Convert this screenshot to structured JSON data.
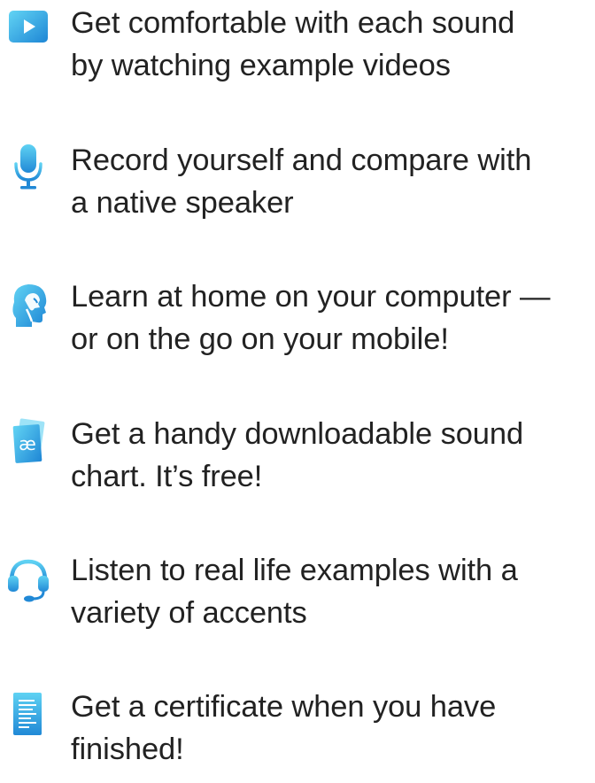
{
  "colors": {
    "accent_light": "#5dcff2",
    "accent_dark": "#1e88d6",
    "text": "#222222",
    "background": "#ffffff"
  },
  "features": [
    {
      "icon": "play-video-icon",
      "text": "Get comfortable with each sound\nby watching example videos"
    },
    {
      "icon": "microphone-icon",
      "text": "Record yourself and compare with\na native speaker"
    },
    {
      "icon": "head-profile-icon",
      "text": "Learn at home on your computer —\nor on the go on your mobile!"
    },
    {
      "icon": "sound-chart-cards-icon",
      "icon_text": "æ",
      "text": "Get a handy downloadable sound\nchart. It’s free!"
    },
    {
      "icon": "headset-icon",
      "text": "Listen to real life examples with a\nvariety of accents"
    },
    {
      "icon": "certificate-document-icon",
      "text": "Get a certificate when you have\nfinished!"
    }
  ]
}
